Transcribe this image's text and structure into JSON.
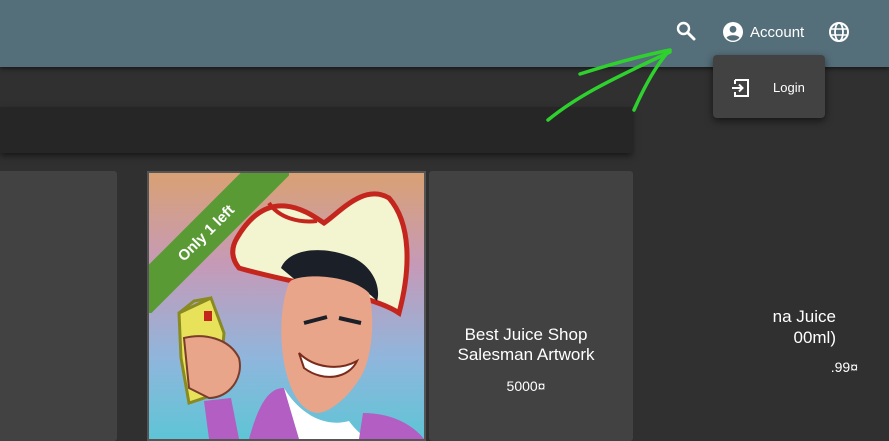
{
  "toolbar": {
    "search_icon": "search-icon",
    "account_label": "Account",
    "account_icon": "account-circle-icon",
    "language_icon": "globe-icon"
  },
  "account_menu": {
    "items": [
      {
        "label": "Login",
        "icon": "login-icon"
      }
    ]
  },
  "products": [
    {
      "name_line1": "na Juice",
      "name_line2": "00ml)",
      "price": ".99¤"
    },
    {
      "ribbon": "Only 1 left",
      "image": "salesman-artwork"
    },
    {
      "name_line1": "Best Juice Shop",
      "name_line2": "Salesman Artwork",
      "price": "5000¤"
    }
  ],
  "colors": {
    "toolbar": "#546e7a",
    "background": "#303030",
    "card": "#424242",
    "ribbon": "#5a9a35",
    "annotation_arrow": "#2fd12f"
  }
}
